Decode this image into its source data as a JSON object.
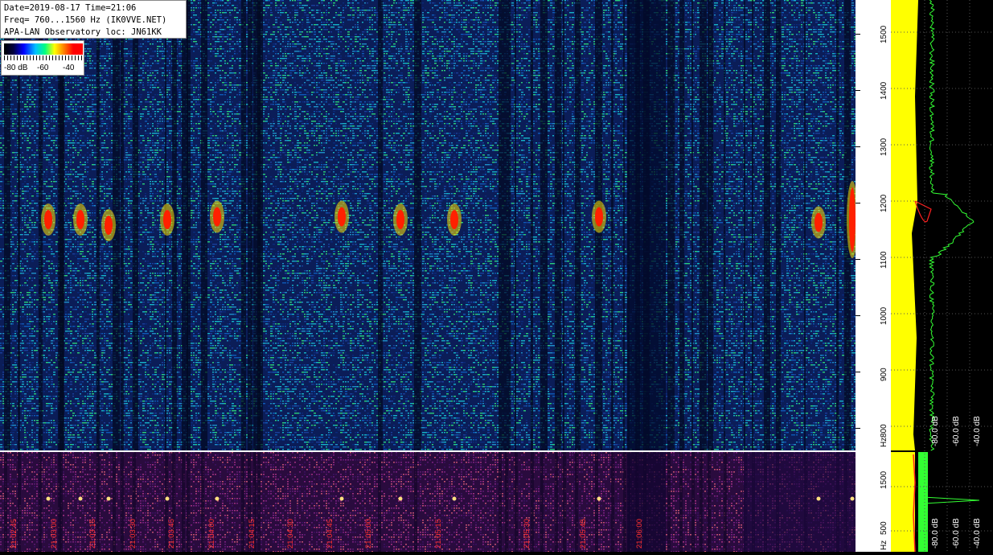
{
  "header": {
    "date_line": "Date=2019-08-17 Time=21:06",
    "freq_line": "Freq= 760...1560 Hz (IK0VVE.NET)",
    "loc_line": "APA-LAN Observatory loc: JN61KK"
  },
  "legend": {
    "labels": [
      "-80 dB",
      "-60",
      "-40"
    ]
  },
  "chart_data": {
    "type": "heatmap",
    "title": "Date=2019-08-17 Time=21:06",
    "subtitle": "Freq= 760...1560 Hz (IK0VVE.NET)",
    "ylabel": "Hz",
    "ylim": [
      760,
      1560
    ],
    "y_ticks": [
      "800",
      "900",
      "1000",
      "1100",
      "1200",
      "1300",
      "1400",
      "1500"
    ],
    "y_unit_label": "Hz",
    "lower_y_ticks": [
      "500",
      "1500"
    ],
    "lower_y_unit_label": "Hz",
    "colorscale_db": [
      -80,
      -60,
      -40
    ],
    "time_ticks": [
      "21:02:45",
      "21:03:00",
      "21:03:15",
      "21:03:30",
      "21:03:45",
      "21:04:00",
      "21:04:15",
      "21:04:30",
      "21:04:45",
      "21:05:00",
      "21:05:15",
      "21:05:30",
      "21:05:45",
      "21:06:00"
    ],
    "meteor_echoes_hz": [
      1170,
      1170,
      1170,
      1175,
      1175,
      1170,
      1170,
      1175,
      1165,
      1170,
      1160
    ],
    "level_axis_labels": [
      "-80.0 dB",
      "-60.0 dB",
      "-40.0 dB"
    ],
    "colors": {
      "background": "#0b1d58",
      "noise": "#1e90c8",
      "echo": "#ff2000",
      "lower_panel": "#2a0b3e",
      "level_trace": "#33ff33",
      "level_fill": "#ffff00",
      "avg_trace": "#ff2020"
    }
  }
}
